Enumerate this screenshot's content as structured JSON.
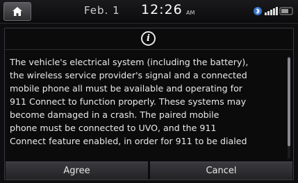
{
  "statusbar": {
    "date": "Feb.  1",
    "time": "12:26",
    "ampm": "AM",
    "icons": [
      "bluetooth-icon",
      "signal-icon"
    ]
  },
  "dialog": {
    "icon": "info-icon",
    "icon_glyph": "i",
    "message": "The vehicle's electrical system (including the battery),\nthe wireless service provider's signal and a connected\nmobile phone all must be available and operating for\n911 Connect to function properly. These systems may\nbecome damaged in a crash. The paired mobile\nphone must be connected to UVO, and the 911\nConnect feature enabled, in order for 911 to be dialed",
    "buttons": {
      "agree": "Agree",
      "cancel": "Cancel"
    }
  },
  "colors": {
    "background": "#0e0e10",
    "text": "#eaeaea",
    "button": "#2e2e32",
    "border": "#3b3b40"
  }
}
